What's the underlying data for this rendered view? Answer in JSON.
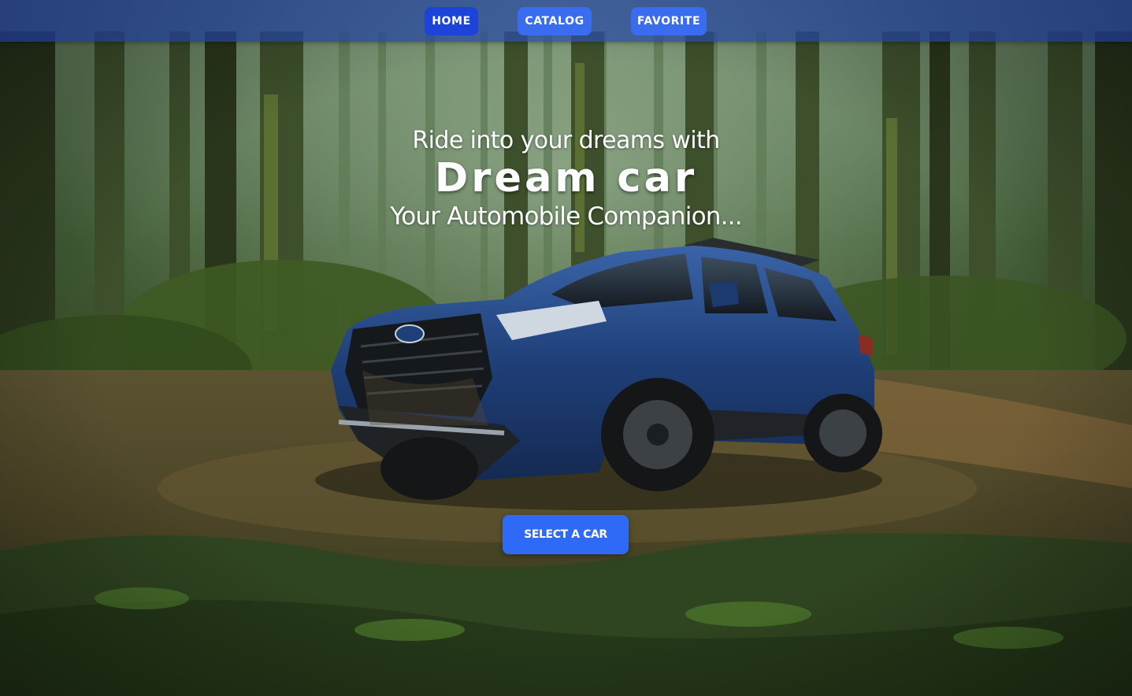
{
  "nav": {
    "items": [
      {
        "label": "HOME",
        "active": true
      },
      {
        "label": "CATALOG",
        "active": false
      },
      {
        "label": "FAVORITE",
        "active": false
      }
    ]
  },
  "hero": {
    "tagline": "Ride into your dreams with",
    "title": "Dream car",
    "subtitle": "Your Automobile Companion...",
    "cta_label": "SELECT A CAR",
    "background": "forest-trail-suv-photo"
  },
  "colors": {
    "nav_bar": "#2c4ea8",
    "nav_active": "#1d44d9",
    "nav_button": "#3a6cf0",
    "cta": "#2f6af6",
    "text": "#ffffff",
    "suv_body": "#1f3f78"
  }
}
